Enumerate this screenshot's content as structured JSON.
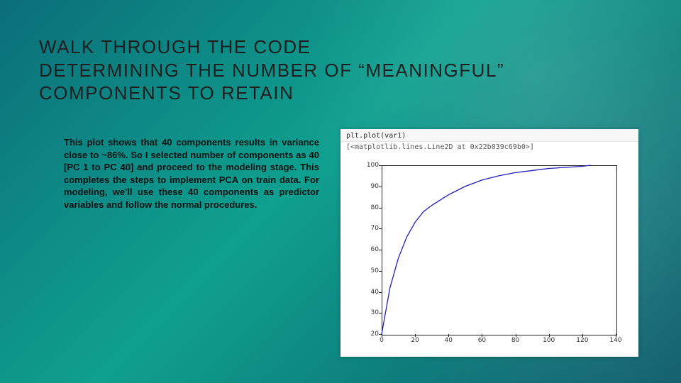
{
  "title": "WALK THROUGH THE CODE\nDETERMINING THE NUMBER OF “MEANINGFUL” COMPONENTS TO RETAIN",
  "body": "This plot shows that 40 components results in variance close to ~86%. So I selected number of components as 40 [PC 1 to PC 40] and proceed to the modeling stage. This completes the steps to implement PCA on train data. For modeling, we'll use these 40 components as predictor variables and follow the normal procedures.",
  "figure": {
    "code_line": "plt.plot(var1)",
    "output_line": "[<matplotlib.lines.Line2D at 0x22b039c69b0>]"
  },
  "chart_data": {
    "type": "line",
    "title": "",
    "xlabel": "",
    "ylabel": "",
    "xlim": [
      0,
      140
    ],
    "ylim": [
      20,
      100
    ],
    "xticks": [
      0,
      20,
      40,
      60,
      80,
      100,
      120,
      140
    ],
    "yticks": [
      20,
      30,
      40,
      50,
      60,
      70,
      80,
      90,
      100
    ],
    "series": [
      {
        "name": "var1",
        "x": [
          0,
          5,
          10,
          15,
          20,
          25,
          30,
          35,
          40,
          50,
          60,
          70,
          80,
          90,
          100,
          110,
          120,
          125
        ],
        "y": [
          20,
          42,
          56,
          66,
          73,
          78,
          81,
          83.5,
          86,
          90,
          93,
          95,
          96.5,
          97.5,
          98.5,
          99,
          99.5,
          100
        ]
      }
    ]
  }
}
